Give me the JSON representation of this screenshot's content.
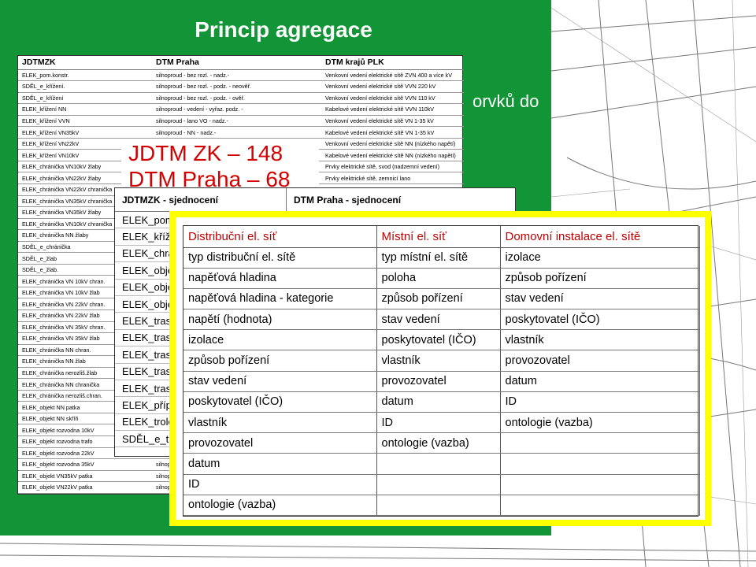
{
  "slide": {
    "title": "Princip agregace",
    "background_text": "orvků  do"
  },
  "colors": {
    "slide_green": "#129537",
    "highlight_border": "#ffff00",
    "count_red": "#d40000",
    "heading_red": "#c00000"
  },
  "table1": {
    "headers": [
      "JDTMZK",
      "DTM Praha",
      "DTM krajů PLK"
    ],
    "rows": [
      [
        "ELEK_pom.konstr.",
        "silnoproud - bez rozl. - nadz.-",
        "Venkovní vedení elektrické sítě ZVN 400 a více kV"
      ],
      [
        "SDĚL_e_křížení.",
        "silnoproud - bez rozl. - podz. - neověř.",
        "Venkovní vedení elektrické sítě VVN 220 kV"
      ],
      [
        "SDĚL_e_křížení",
        "silnoproud - bez rozl. - podz. - ověř.",
        "Venkovní vedení elektrické sítě VVN 110 kV"
      ],
      [
        "ELEK_křížení NN",
        "silnoproud - vedení - vyřaz. podz. -",
        "Kabelové vedení elektrické sítě VVN 110kV"
      ],
      [
        "ELEK_křížení VVN",
        "silnoproud - lano VO - nadz.-",
        "Venkovní vedení elektrické sítě VN 1-35 kV"
      ],
      [
        "ELEK_křížení VN35kV",
        "silnoproud - NN - nadz.-",
        "Kabelové vedení elektrické sítě VN 1-35 kV"
      ],
      [
        "ELEK_křížení VN22kV",
        "",
        "Venkovní vedení elektrické sítě NN (nízkého napětí)"
      ],
      [
        "ELEK_křížení VN10kV",
        "",
        "Kabelové vedení elektrické sítě NN (nízkého napětí)"
      ],
      [
        "ELEK_chránička VN10kV žlaby",
        "",
        "Prvky elektrické sítě, svod (nadzemní vedení)"
      ],
      [
        "ELEK_chránička VN22kV žlaby",
        "",
        "Prvky elektrické sítě, zemnicí lano"
      ],
      [
        "ELEK_chránička VN22kV chranička",
        "",
        ""
      ],
      [
        "ELEK_chránička VN35kV chranička",
        "",
        ""
      ],
      [
        "ELEK_chránička VN35kV žlaby",
        "",
        ""
      ],
      [
        "ELEK_chránička VN10kV chranička",
        "",
        ""
      ],
      [
        "ELEK_chránička NN žlaby",
        "",
        ""
      ],
      [
        "SDĚL_e_chránička",
        "",
        ""
      ],
      [
        "SDĚL_e_žlab",
        "",
        ""
      ],
      [
        "SDĚL_e_žlab.",
        "",
        ""
      ],
      [
        "ELEK_chránička VN 10kV chran.",
        "",
        ""
      ],
      [
        "ELEK_chránička VN 10kV žlab",
        "",
        ""
      ],
      [
        "ELEK_chránička VN 22kV chran.",
        "",
        ""
      ],
      [
        "ELEK_chránička VN 22kV žlab",
        "",
        ""
      ],
      [
        "ELEK_chránička VN 35kV chran.",
        "",
        ""
      ],
      [
        "ELEK_chránička VN 35kV žlab",
        "",
        ""
      ],
      [
        "ELEK_chránička NN chran.",
        "",
        ""
      ],
      [
        "ELEK_chránička NN žlab",
        "",
        ""
      ],
      [
        "ELEK_chránička nerozliš.žlab",
        "",
        ""
      ],
      [
        "ELEK_chránička NN chranička",
        "",
        ""
      ],
      [
        "ELEK_chránička nerozliš.chran.",
        "",
        ""
      ],
      [
        "ELEK_objekt NN patka",
        "",
        ""
      ],
      [
        "ELEK_objekt NN skříň",
        "",
        ""
      ],
      [
        "ELEK_objekt rozvodna 10kV",
        "",
        ""
      ],
      [
        "ELEK_objekt rozvodna trafo",
        "",
        ""
      ],
      [
        "ELEK_objekt rozvodna 22kV",
        "",
        ""
      ],
      [
        "ELEK_objekt rozvodna 35kV",
        "silnop",
        ""
      ],
      [
        "ELEK_objekt VN35kV patka",
        "silnop",
        ""
      ],
      [
        "ELEK_objekt VN22kV patka",
        "silnop",
        ""
      ]
    ]
  },
  "counts": {
    "line1": "JDTM ZK – 148",
    "line2": "DTM Praha – 68"
  },
  "table2": {
    "headers": [
      "JDTMZK - sjednocení",
      "DTM Praha - sjednocení"
    ],
    "rows": [
      "ELEK_pom.",
      "ELEK_křížen",
      "ELEK_chrán",
      "ELEK_objek",
      "ELEK_objek",
      "ELEK_objek",
      "ELEK_trasa",
      "ELEK_trasa",
      "ELEK_trasa",
      "ELEK_trasa",
      "ELEK_trasa",
      "ELEK_přípo",
      "ELEK_trolej",
      "SDĚL_e_tra"
    ]
  },
  "table3": {
    "headers": [
      "Distribuční el. síť",
      "Místní el. síť",
      "Domovní instalace el. sítě"
    ],
    "rows": [
      [
        "typ distribuční el. sítě",
        "typ místní el. sítě",
        "izolace"
      ],
      [
        "napěťová hladina",
        "poloha",
        "způsob pořízení"
      ],
      [
        "napěťová hladina - kategorie",
        "způsob pořízení",
        "stav vedení"
      ],
      [
        "napětí (hodnota)",
        "stav vedení",
        "poskytovatel (IČO)"
      ],
      [
        "izolace",
        "poskytovatel (IČO)",
        "vlastník"
      ],
      [
        "způsob pořízení",
        "vlastník",
        "provozovatel"
      ],
      [
        "stav vedení",
        "provozovatel",
        "datum"
      ],
      [
        "poskytovatel (IČO)",
        "datum",
        "ID"
      ],
      [
        "vlastník",
        "ID",
        "ontologie (vazba)"
      ],
      [
        "provozovatel",
        "ontologie (vazba)",
        ""
      ],
      [
        "datum",
        "",
        ""
      ],
      [
        "ID",
        "",
        ""
      ],
      [
        "ontologie (vazba)",
        "",
        ""
      ]
    ]
  }
}
